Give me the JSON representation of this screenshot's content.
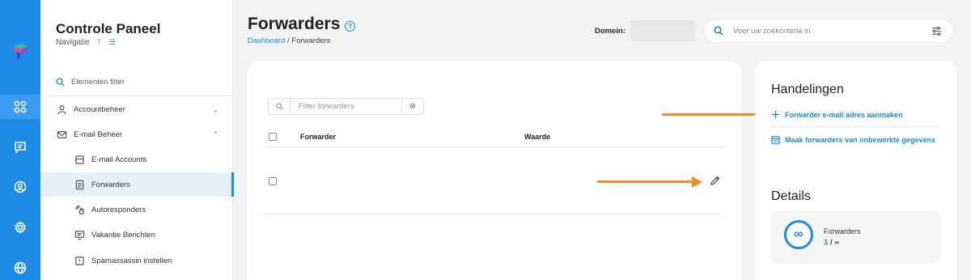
{
  "sidebar": {
    "title": "Controle Paneel",
    "subtitle": "Navigatie",
    "filter_placeholder": "Elementen filter",
    "items": [
      {
        "label": "Accountbeheer"
      },
      {
        "label": "E-mail Beheer"
      },
      {
        "label": "E-mail Accounts"
      },
      {
        "label": "Forwarders"
      },
      {
        "label": "Autoresponders"
      },
      {
        "label": "Vakantie Berichten"
      },
      {
        "label": "Spamassassin instellen"
      }
    ]
  },
  "header": {
    "title": "Forwarders",
    "breadcrumb_link": "Dashboard",
    "breadcrumb_current": "/ Forwarders",
    "domain_label": "Domein:",
    "search_placeholder": "Voer uw zoekcriteria in"
  },
  "table": {
    "filter_placeholder": "Filter forwarders",
    "columns": [
      "Forwarder",
      "Waarde"
    ]
  },
  "actions": {
    "heading": "Handelingen",
    "create": "Forwarder e-mail adres aanmaken",
    "bulk": "Maak forwarders van onbewerkte gegevens"
  },
  "details": {
    "heading": "Details",
    "label": "Forwarders",
    "count": "1",
    "separator": "/",
    "limit": "∞",
    "icon": "∞"
  },
  "colors": {
    "accent": "#1d8ae8",
    "arrow": "#f28c28"
  }
}
